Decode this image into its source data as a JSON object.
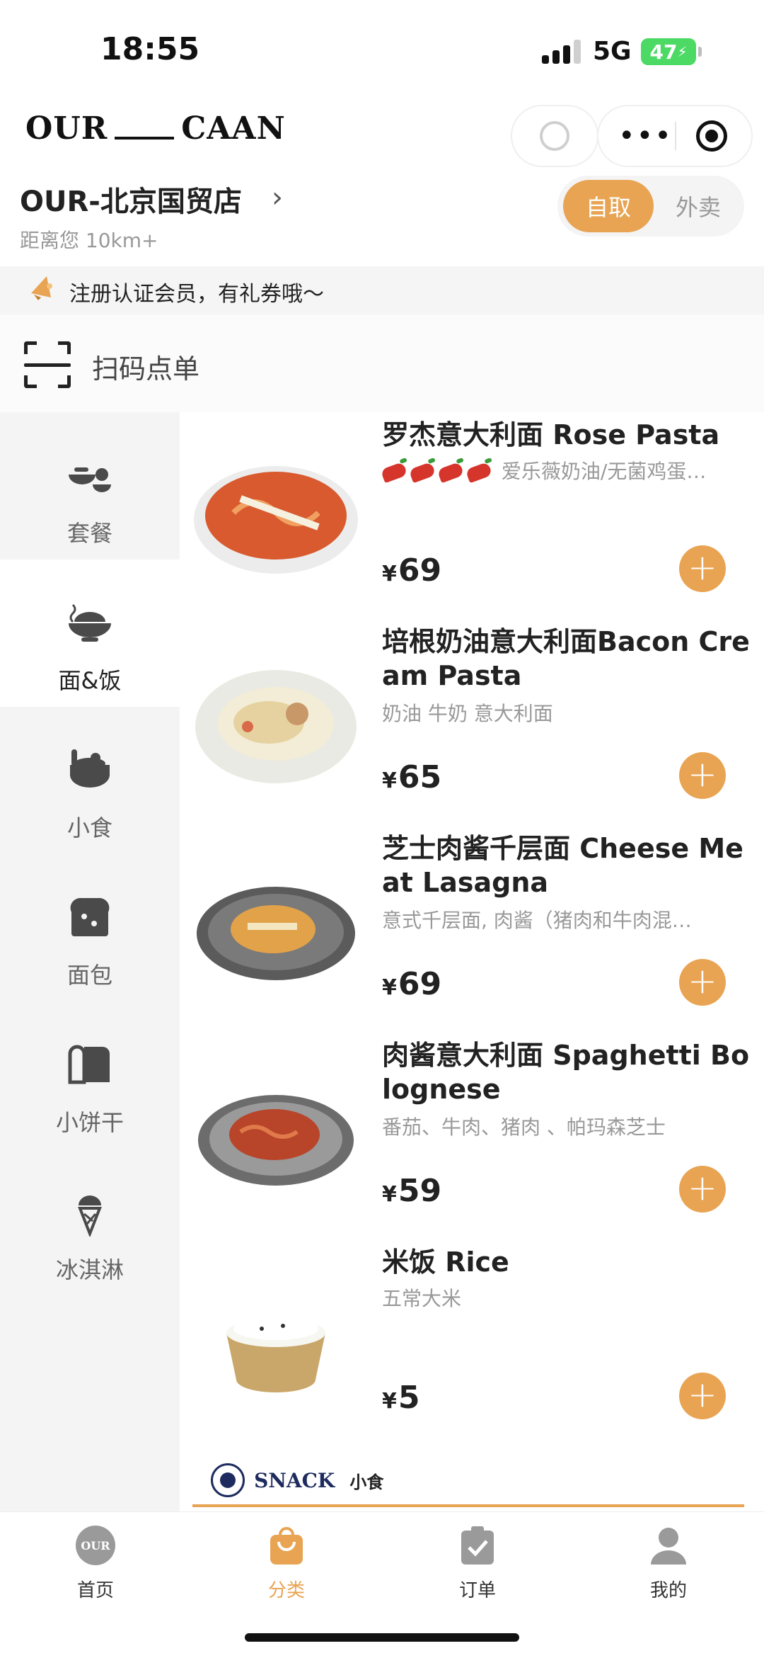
{
  "status_bar": {
    "time": "18:55",
    "network": "5G",
    "battery": "47"
  },
  "header": {
    "logo_left": "OUR",
    "logo_right": "CAAN",
    "store_name": "OUR-北京国贸店",
    "distance": "距离您 10km+",
    "mode_pickup": "自取",
    "mode_delivery": "外卖"
  },
  "notice": {
    "text": "注册认证会员，有礼券哦～"
  },
  "scan": {
    "label": "扫码点单"
  },
  "sidebar": {
    "items": [
      {
        "label": "套餐",
        "icon": "set-meal-icon",
        "active": false
      },
      {
        "label": "面&饭",
        "icon": "noodle-bowl-icon",
        "active": true
      },
      {
        "label": "小食",
        "icon": "snack-icon",
        "active": false
      },
      {
        "label": "面包",
        "icon": "bread-icon",
        "active": false
      },
      {
        "label": "小饼干",
        "icon": "cookie-icon",
        "active": false
      },
      {
        "label": "冰淇淋",
        "icon": "ice-cream-icon",
        "active": false
      }
    ]
  },
  "products": [
    {
      "title": "罗杰意大利面 Rose Pasta",
      "desc": "爱乐薇奶油/无菌鸡蛋…",
      "spicy": 4,
      "currency": "¥",
      "price": "69"
    },
    {
      "title": "培根奶油意大利面Bacon Cream Pasta",
      "desc": "奶油 牛奶 意大利面",
      "spicy": 0,
      "currency": "¥",
      "price": "65"
    },
    {
      "title": "芝士肉酱千层面 Cheese Meat Lasagna",
      "desc": "意式千层面, 肉酱（猪肉和牛肉混…",
      "spicy": 0,
      "currency": "¥",
      "price": "69"
    },
    {
      "title": "肉酱意大利面 Spaghetti Bolognese",
      "desc": "番茄、牛肉、猪肉 、帕玛森芝士",
      "spicy": 0,
      "currency": "¥",
      "price": "59"
    },
    {
      "title": "米饭 Rice",
      "desc": "五常大米",
      "spicy": 0,
      "currency": "¥",
      "price": "5"
    }
  ],
  "section": {
    "title": "SNACK",
    "subtitle": "小食"
  },
  "tabbar": {
    "items": [
      {
        "label": "首页",
        "icon": "home-logo-icon"
      },
      {
        "label": "分类",
        "icon": "shopping-bag-icon"
      },
      {
        "label": "订单",
        "icon": "clipboard-check-icon"
      },
      {
        "label": "我的",
        "icon": "user-icon"
      }
    ]
  },
  "colors": {
    "accent": "#e8a453",
    "battery": "#4cd964",
    "brand_navy": "#1d2b5e"
  }
}
